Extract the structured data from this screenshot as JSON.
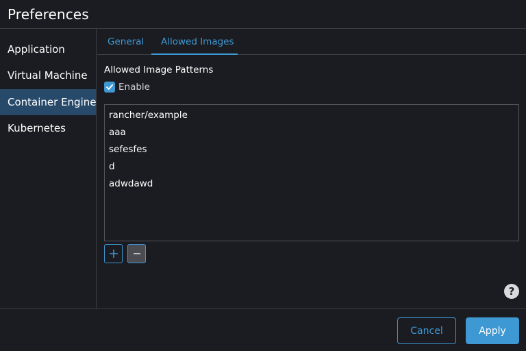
{
  "window": {
    "title": "Preferences"
  },
  "sidebar": {
    "items": [
      {
        "label": "Application",
        "active": false
      },
      {
        "label": "Virtual Machine",
        "active": false
      },
      {
        "label": "Container Engine",
        "active": true
      },
      {
        "label": "Kubernetes",
        "active": false
      }
    ]
  },
  "tabs": [
    {
      "label": "General",
      "active": false
    },
    {
      "label": "Allowed Images",
      "active": true
    }
  ],
  "allowed_images": {
    "section_label": "Allowed Image Patterns",
    "enable_label": "Enable",
    "enabled": true,
    "patterns": [
      "rancher/example",
      "aaa",
      "sefesfes",
      "d",
      "adwdawd"
    ],
    "add_icon": "plus-icon",
    "remove_icon": "minus-icon",
    "help_icon": "question-icon",
    "help_symbol": "?"
  },
  "footer": {
    "cancel_label": "Cancel",
    "apply_label": "Apply"
  },
  "colors": {
    "background": "#1b1c21",
    "accent": "#3d98d3",
    "active_nav": "#284a6a",
    "border": "#3d3e44"
  }
}
